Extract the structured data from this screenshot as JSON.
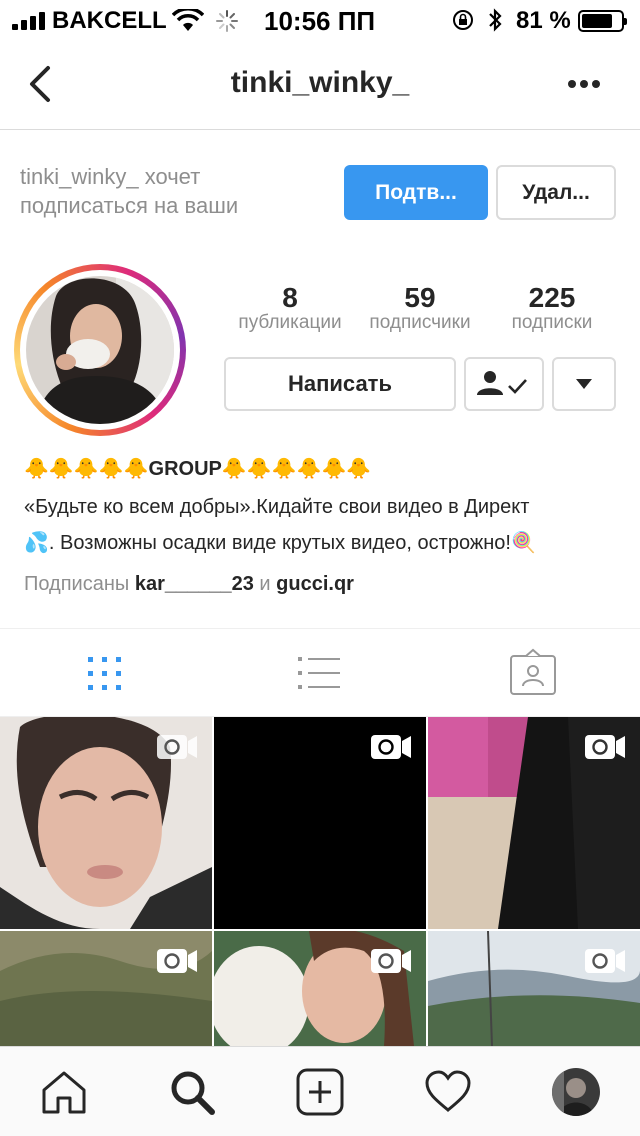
{
  "status_bar": {
    "carrier": "BAKCELL",
    "time": "10:56 ПП",
    "battery_percent": "81 %",
    "battery_level": 0.81
  },
  "nav": {
    "username": "tinki_winky_"
  },
  "follow_request": {
    "text": "tinki_winky_ хочет подписаться на ваши",
    "confirm_label": "Подтв...",
    "delete_label": "Удал..."
  },
  "stats": [
    {
      "value": "8",
      "label": "публикации"
    },
    {
      "value": "59",
      "label": "подписчики"
    },
    {
      "value": "225",
      "label": "подписки"
    }
  ],
  "actions": {
    "message_label": "Написать"
  },
  "bio": {
    "line1": "🐥🐥🐥🐥🐥GROUP🐥🐥🐥🐥🐥🐥",
    "line2": "«Будьте ко всем добры».Кидайте свои видео в Директ",
    "line3": "💦. Возможны осадки виде крутых видео, острожно!🍭",
    "followed_prefix": "Подписаны",
    "followed_user1": "kar______23",
    "followed_and": "и",
    "followed_user2": "gucci.qr"
  },
  "tabs": [
    {
      "name": "grid",
      "active": true
    },
    {
      "name": "list",
      "active": false
    },
    {
      "name": "tagged",
      "active": false
    }
  ],
  "grid_tiles": [
    {
      "icon": "video-icon"
    },
    {
      "icon": "video-icon"
    },
    {
      "icon": "video-icon"
    },
    {
      "icon": "video-icon"
    },
    {
      "icon": "video-icon"
    },
    {
      "icon": "video-icon"
    }
  ],
  "bottom_nav": [
    "home-icon",
    "search-icon",
    "add-icon",
    "heart-icon",
    "profile-avatar"
  ],
  "colors": {
    "accent": "#3897f0",
    "text": "#262626",
    "muted": "#8e8e8e",
    "border": "#dbdbdb"
  }
}
